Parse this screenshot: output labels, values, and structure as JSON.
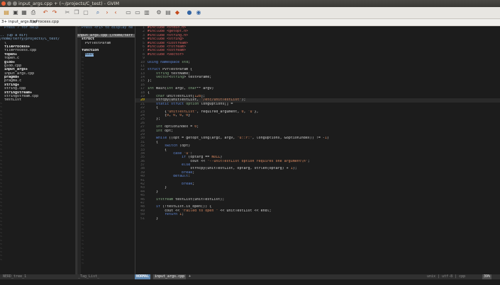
{
  "window": {
    "title": "input_args.cpp + (~/projects/C_test) - GVIM"
  },
  "tabs": [
    {
      "label": "3+ input_args.cpp"
    },
    {
      "label": "fileProcess.cpp"
    }
  ],
  "toolbar_icons": [
    "open-icon",
    "save-icon",
    "save-all-icon",
    "print-icon",
    "undo-icon",
    "redo-icon",
    "cut-icon",
    "copy-icon",
    "paste-icon",
    "find-replace-icon",
    "find-next-icon",
    "find-prev-icon",
    "load-session-icon",
    "save-session-icon",
    "run-script-icon",
    "make-icon",
    "run-ctags-icon",
    "jump-tag-icon",
    "help-icon",
    "find-help-icon"
  ],
  "left_pane": {
    "help": "\" Press ? for help",
    "dir_up": ".. (up a dir)",
    "cwd": "/home/terry/projects/C_test/",
    "entries": [
      {
        "text": "\\",
        "bold": false
      },
      {
        "text": "fileProcess+",
        "bold": true
      },
      {
        "text": "fileProcess.cpp",
        "bold": false
      },
      {
        "text": "fopen+",
        "bold": true
      },
      {
        "text": "fopen.c",
        "bold": false
      },
      {
        "text": "glob+",
        "bold": true
      },
      {
        "text": "glob.cpp",
        "bold": false
      },
      {
        "text": "input_args+",
        "bold": true
      },
      {
        "text": "input_args.cpp",
        "bold": false
      },
      {
        "text": "pragma+",
        "bold": true
      },
      {
        "text": "pragma.c",
        "bold": false
      },
      {
        "text": "string+",
        "bold": true
      },
      {
        "text": "string.cpp",
        "bold": false
      },
      {
        "text": "stringstream+",
        "bold": true
      },
      {
        "text": "stringstream.cpp",
        "bold": false
      },
      {
        "text": "testList",
        "bold": false
      }
    ]
  },
  "mid_pane": {
    "help": "\" Press <F1> to display he",
    "header": "input_args.cpp (/home/terr",
    "items": [
      {
        "text": "struct",
        "kind": "kind"
      },
      {
        "text": "PvrTestParam",
        "kind": "item"
      },
      {
        "text": "",
        "kind": "blank"
      },
      {
        "text": "function",
        "kind": "kind"
      },
      {
        "text": "main",
        "kind": "selected"
      }
    ]
  },
  "code": {
    "current_line": 20,
    "lines": [
      {
        "n": 1,
        "t": "#include <stdio.h>"
      },
      {
        "n": 2,
        "t": "#include <getopt.h>"
      },
      {
        "n": 3,
        "t": "#include <string.h>"
      },
      {
        "n": 4,
        "t": "#include <string>"
      },
      {
        "n": 5,
        "t": "#include <iostream>"
      },
      {
        "n": 6,
        "t": "#include <fstream>"
      },
      {
        "n": 7,
        "t": "#include <sstream>"
      },
      {
        "n": 8,
        "t": "#include <vector>"
      },
      {
        "n": 9,
        "t": ""
      },
      {
        "n": 10,
        "t": "using namespace std;"
      },
      {
        "n": 11,
        "t": ""
      },
      {
        "n": 12,
        "t": "struct PvrTestParam {"
      },
      {
        "n": 13,
        "t": "    string testName;"
      },
      {
        "n": 14,
        "t": "    vector<string> testParame;"
      },
      {
        "n": 15,
        "t": "};"
      },
      {
        "n": 16,
        "t": ""
      },
      {
        "n": 17,
        "t": "int main(int argc, char** argv)"
      },
      {
        "n": 18,
        "t": "{"
      },
      {
        "n": 19,
        "t": "    char unitTestList[128];"
      },
      {
        "n": 20,
        "t": "    strcpy(unitTestList, \"/etc/unitTestList\");"
      },
      {
        "n": 21,
        "t": "    static struct option longOptions[] ="
      },
      {
        "n": 22,
        "t": "    {"
      },
      {
        "n": 23,
        "t": "        {\"unitTestList\", required_argument, 0, 'u'},"
      },
      {
        "n": 24,
        "t": "        {0, 0, 0, 0}"
      },
      {
        "n": 25,
        "t": "    };"
      },
      {
        "n": 26,
        "t": ""
      },
      {
        "n": 27,
        "t": "    int optionIndex = 0;"
      },
      {
        "n": 28,
        "t": "    int opt;"
      },
      {
        "n": 29,
        "t": ""
      },
      {
        "n": 30,
        "t": "    while ((opt = getopt_long(argc, argv, \"u::r:\", longOptions, &optionIndex)) != -1)"
      },
      {
        "n": 31,
        "t": "    {"
      },
      {
        "n": 32,
        "t": "        switch (opt)"
      },
      {
        "n": 33,
        "t": "        {"
      },
      {
        "n": 34,
        "t": "            case 'u':"
      },
      {
        "n": 35,
        "t": "                if (optarg == NULL)"
      },
      {
        "n": 36,
        "t": "                    cout << \"--unitTestList option requires one argument\\n\";"
      },
      {
        "n": 37,
        "t": "                else"
      },
      {
        "n": 38,
        "t": "                    strncpy(unitTestList, optarg, strlen(optarg) + 1);"
      },
      {
        "n": 39,
        "t": "                break;"
      },
      {
        "n": 40,
        "t": "            default:"
      },
      {
        "n": 41,
        "t": ""
      },
      {
        "n": 42,
        "t": "                break;"
      },
      {
        "n": 43,
        "t": "        }"
      },
      {
        "n": 44,
        "t": "    }"
      },
      {
        "n": 45,
        "t": ""
      },
      {
        "n": 46,
        "t": "    ifstream testList(unitTestList);"
      },
      {
        "n": 47,
        "t": ""
      },
      {
        "n": 48,
        "t": "    if (!testList.is_open()) {"
      },
      {
        "n": 49,
        "t": "        cout << \"Failed to open \" << unitTestList << endl;"
      },
      {
        "n": 50,
        "t": "        return 1;"
      },
      {
        "n": 51,
        "t": "    }"
      }
    ]
  },
  "statusline": {
    "left": "NERD_tree_1",
    "mid": "_Tag_List_",
    "mode": "NORMAL",
    "file": "input_args.cpp",
    "modified": "+",
    "format": "unix | utf-8 | cpp",
    "pos": "39%"
  },
  "colors": {
    "accent": "#5f87af",
    "background": "#1c1c1c",
    "cursor_line_number": "#ffd700"
  }
}
